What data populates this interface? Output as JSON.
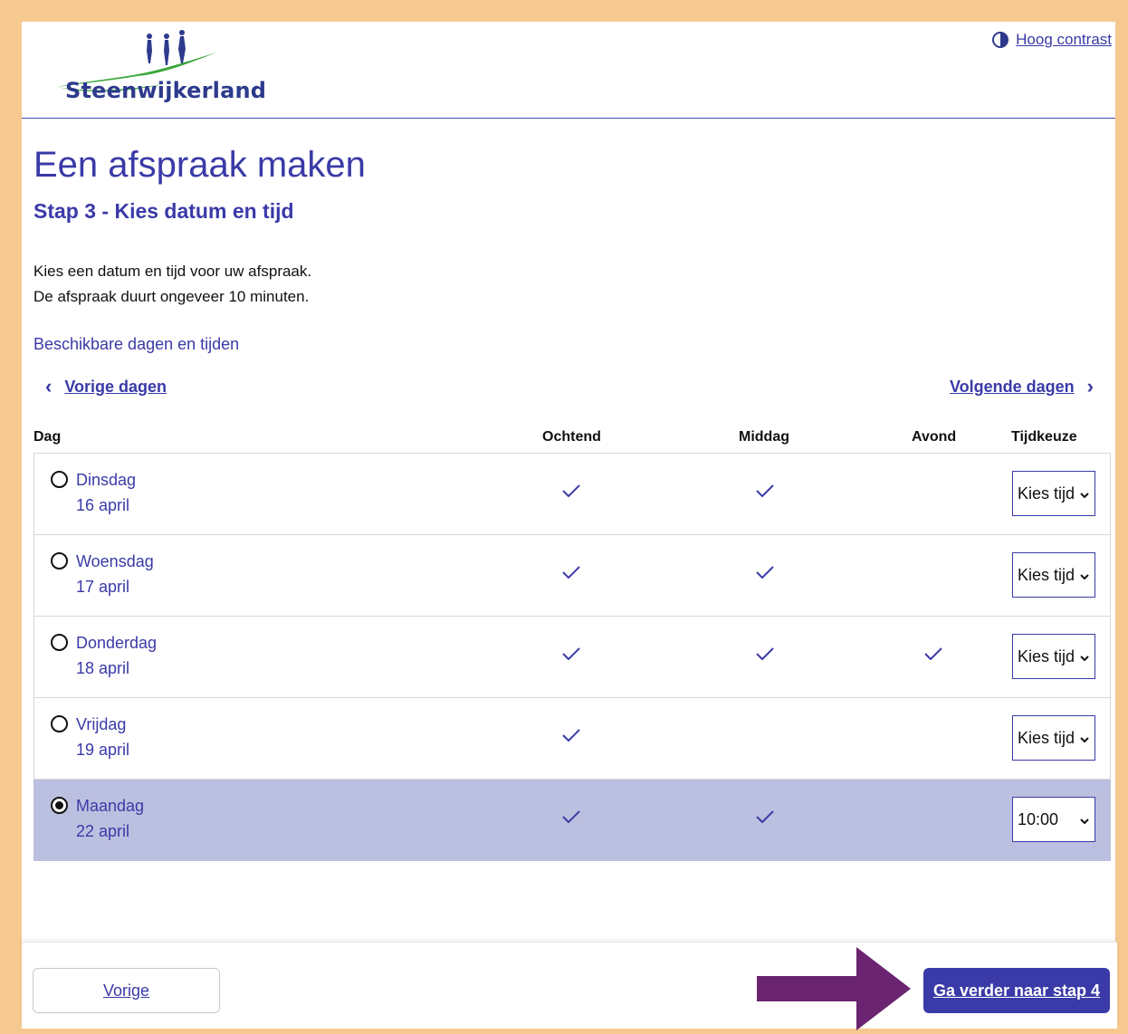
{
  "header": {
    "logo_text": "Steenwijkerland",
    "contrast_label": "Hoog contrast"
  },
  "main": {
    "title": "Een afspraak maken",
    "subtitle": "Stap 3 - Kies datum en tijd",
    "intro_line1": "Kies een datum en tijd voor uw afspraak.",
    "intro_line2": "De afspraak duurt ongeveer 10 minuten.",
    "available_heading": "Beschikbare dagen en tijden",
    "prev_days": "Vorige dagen",
    "next_days": "Volgende dagen"
  },
  "table": {
    "headers": [
      "Dag",
      "Ochtend",
      "Middag",
      "Avond",
      "Tijdkeuze"
    ],
    "rows": [
      {
        "day": "Dinsdag",
        "date": "16 april",
        "morning": true,
        "afternoon": true,
        "evening": false,
        "time": "Kies tijd",
        "selected": false
      },
      {
        "day": "Woensdag",
        "date": "17 april",
        "morning": true,
        "afternoon": true,
        "evening": false,
        "time": "Kies tijd",
        "selected": false
      },
      {
        "day": "Donderdag",
        "date": "18 april",
        "morning": true,
        "afternoon": true,
        "evening": true,
        "time": "Kies tijd",
        "selected": false
      },
      {
        "day": "Vrijdag",
        "date": "19 april",
        "morning": true,
        "afternoon": false,
        "evening": false,
        "time": "Kies tijd",
        "selected": false
      },
      {
        "day": "Maandag",
        "date": "22 april",
        "morning": true,
        "afternoon": true,
        "evening": false,
        "time": "10:00",
        "selected": true
      }
    ]
  },
  "footer": {
    "prev_label": "Vorige",
    "next_label": "Ga verder naar stap 4"
  },
  "colors": {
    "accent": "#3a3aa8",
    "selected_row": "#bcc0e0",
    "frame": "#f6c990",
    "arrow": "#6b2470"
  },
  "icons": [
    "logo-figures-icon",
    "contrast-icon",
    "chevron-left-icon",
    "chevron-right-icon",
    "check-icon",
    "chevron-down-icon",
    "arrow-right-icon"
  ]
}
